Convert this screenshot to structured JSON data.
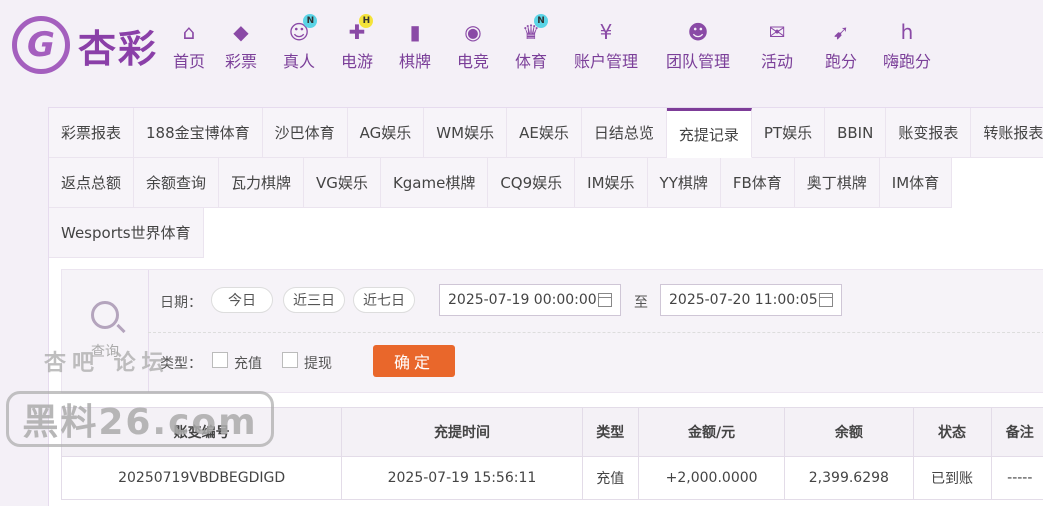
{
  "brand": {
    "logo_letter": "G",
    "name": "杏彩"
  },
  "nav": [
    {
      "label": "首页",
      "icon": "home-icon",
      "badge": ""
    },
    {
      "label": "彩票",
      "icon": "ticket-icon",
      "badge": ""
    },
    {
      "label": "真人",
      "icon": "dealer-icon",
      "badge": "N"
    },
    {
      "label": "电游",
      "icon": "gamepad-icon",
      "badge": "H"
    },
    {
      "label": "棋牌",
      "icon": "cards-icon",
      "badge": ""
    },
    {
      "label": "电竞",
      "icon": "controller-icon",
      "badge": ""
    },
    {
      "label": "体育",
      "icon": "trophy-icon",
      "badge": "N"
    },
    {
      "label": "账户管理",
      "icon": "account-icon",
      "badge": ""
    },
    {
      "label": "团队管理",
      "icon": "team-icon",
      "badge": ""
    },
    {
      "label": "活动",
      "icon": "gift-icon",
      "badge": ""
    },
    {
      "label": "跑分",
      "icon": "running-icon",
      "badge": ""
    },
    {
      "label": "嗨跑分",
      "icon": "hi-icon",
      "badge": ""
    }
  ],
  "tabs": {
    "row1": [
      "彩票报表",
      "188金宝博体育",
      "沙巴体育",
      "AG娱乐",
      "WM娱乐",
      "AE娱乐",
      "日结总览",
      "充提记录",
      "PT娱乐",
      "BBIN",
      "账变报表",
      "转账报表"
    ],
    "row2": [
      "返点总额",
      "余额查询",
      "瓦力棋牌",
      "VG娱乐",
      "Kgame棋牌",
      "CQ9娱乐",
      "IM娱乐",
      "YY棋牌",
      "FB体育",
      "奥丁棋牌",
      "IM体育"
    ],
    "row3": [
      "Wesports世界体育"
    ],
    "active": "充提记录"
  },
  "filter": {
    "query_label": "查询",
    "date_label": "日期：",
    "quick": [
      "今日",
      "近三日",
      "近七日"
    ],
    "start": "2025-07-19 00:00:00",
    "to_label": "至",
    "end": "2025-07-20 11:00:05",
    "type_label": "类型：",
    "type_recharge": "充值",
    "type_withdraw": "提现",
    "confirm": "确定"
  },
  "table": {
    "headers": [
      "账变编号",
      "充提时间",
      "类型",
      "金额/元",
      "余额",
      "状态",
      "备注"
    ],
    "rows": [
      [
        "20250719VBDBEGDIGD",
        "2025-07-19 15:56:11",
        "充值",
        "+2,000.0000",
        "2,399.6298",
        "已到账",
        "-----"
      ]
    ]
  },
  "watermark": {
    "top": "杏吧 论坛",
    "main": "黑料26.com"
  }
}
